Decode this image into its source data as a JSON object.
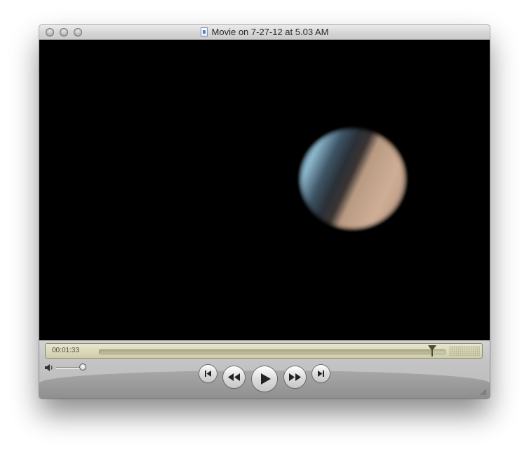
{
  "window": {
    "title": "Movie on 7-27-12 at 5.03 AM"
  },
  "controller": {
    "current_time": "00:01:33",
    "playback_position": 0.965,
    "volume_level": 0.9
  },
  "icons": {
    "close": "close-icon",
    "minimize": "minimize-icon",
    "zoom": "zoom-icon",
    "document": "movie-document-icon",
    "volume": "speaker-icon",
    "go_to_start": "skip-back-icon",
    "rewind": "rewind-icon",
    "play": "play-icon",
    "fast_forward": "fast-forward-icon",
    "go_to_end": "skip-forward-icon",
    "resize": "resize-grip-icon"
  },
  "colors": {
    "timebar": "#e7e6cf",
    "video_background": "#000000",
    "controller": "#c3c3c3"
  }
}
